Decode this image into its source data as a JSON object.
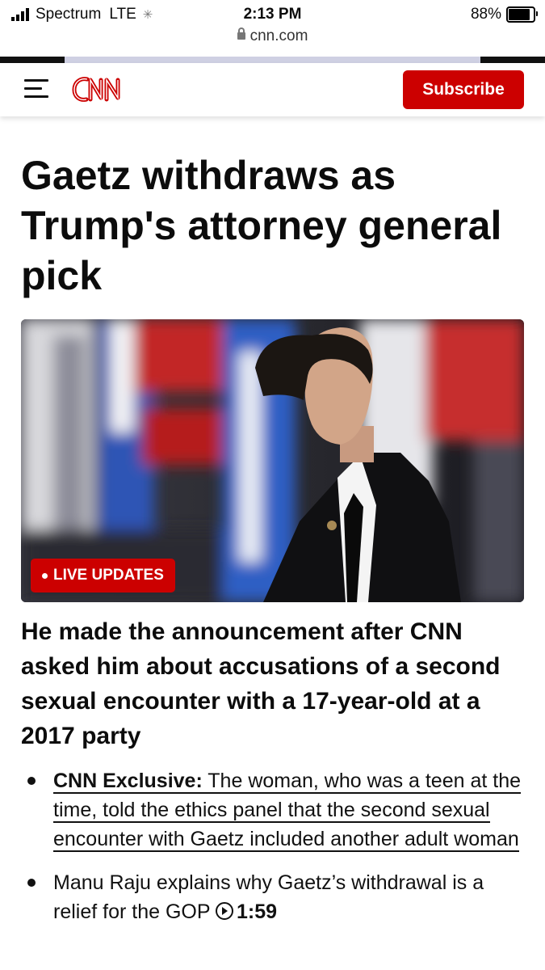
{
  "status_bar": {
    "carrier": "Spectrum",
    "network": "LTE",
    "time": "2:13 PM",
    "url": "cnn.com",
    "battery": "88%",
    "battery_level": 0.88
  },
  "header": {
    "logo_text": "CNN",
    "subscribe_label": "Subscribe",
    "brand_color": "#cc0000"
  },
  "article": {
    "headline": "Gaetz withdraws as Trump's attorney general pick",
    "badge": "LIVE UPDATES",
    "summary": "He made the announcement after CNN asked him about accusations of a second sexual encounter with a 17-year-old at a 2017 party",
    "bullets": [
      {
        "lead": "CNN Exclusive:",
        "text": " The woman, who was a teen at the time, told the ethics panel that the second sexual encounter with Gaetz included another adult woman"
      },
      {
        "text": "Manu Raju explains why Gaetz’s withdrawal is a relief for the GOP ",
        "video_duration": "1:59"
      }
    ]
  }
}
